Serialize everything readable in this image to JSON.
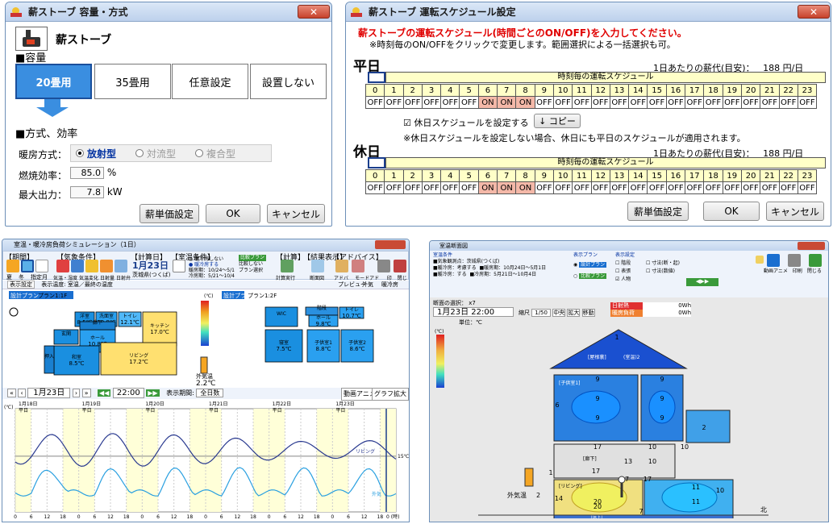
{
  "w1": {
    "title": "薪ストーブ 容量・方式",
    "close": "✕",
    "stove_name": "薪ストーブ",
    "capacity_heading": "■容量",
    "capacity_options": [
      "20畳用",
      "35畳用",
      "任意設定",
      "設置しない"
    ],
    "method_heading": "■方式、効率",
    "heating_label": "暖房方式：",
    "methods": [
      "放射型",
      "対流型",
      "複合型"
    ],
    "eff_label": "燃焼効率：",
    "eff_value": "85.0",
    "eff_unit": "%",
    "power_label": "最大出力：",
    "power_value": "7.8",
    "power_unit": "kW",
    "btn_price": "薪単価設定",
    "btn_ok": "OK",
    "btn_cancel": "キャンセル"
  },
  "w2": {
    "title": "薪ストーブ 運転スケジュール設定",
    "close": "✕",
    "instr1": "薪ストーブの運転スケジュール(時間ごとのON/OFF)を入力してください。",
    "instr2": "※時刻毎のON/OFFをクリックで変更します。範囲選択による一括選択も可。",
    "weekday": "平日",
    "holiday": "休日",
    "daily_label": "1日あたりの薪代(目安)：",
    "daily_value": "188 円/日",
    "grid_title": "時刻毎の運転スケジュール",
    "hours": [
      "0",
      "1",
      "2",
      "3",
      "4",
      "5",
      "6",
      "7",
      "8",
      "9",
      "10",
      "11",
      "12",
      "13",
      "14",
      "15",
      "16",
      "17",
      "18",
      "19",
      "20",
      "21",
      "22",
      "23"
    ],
    "weekday_states": [
      "OFF",
      "OFF",
      "OFF",
      "OFF",
      "OFF",
      "OFF",
      "ON",
      "ON",
      "ON",
      "OFF",
      "OFF",
      "OFF",
      "OFF",
      "OFF",
      "OFF",
      "OFF",
      "OFF",
      "OFF",
      "OFF",
      "OFF",
      "OFF",
      "OFF",
      "OFF",
      "OFF"
    ],
    "holiday_states": [
      "OFF",
      "OFF",
      "OFF",
      "OFF",
      "OFF",
      "OFF",
      "ON",
      "ON",
      "ON",
      "OFF",
      "OFF",
      "OFF",
      "OFF",
      "OFF",
      "OFF",
      "OFF",
      "OFF",
      "OFF",
      "OFF",
      "OFF",
      "OFF",
      "OFF",
      "OFF",
      "OFF"
    ],
    "holiday_check": "休日スケジュールを設定する",
    "copy_btn": "↓ コピー",
    "note": "※休日スケジュールを設定しない場合、休日にも平日のスケジュールが適用されます。",
    "btn_price": "薪単価設定",
    "btn_ok": "OK",
    "btn_cancel": "キャンセル"
  },
  "w3": {
    "title": "室温・暖冷房負荷シミュレーション（1日）",
    "toolbar_groups": [
      "【期間】",
      "【気象条件】",
      "【計算日】",
      "【室温条件】",
      "【計算】",
      "【結果表示】",
      "【アドバイス】"
    ],
    "season_btns": [
      "夏",
      "冬",
      "指定月"
    ],
    "weather_btns": [
      "気温・湿度",
      "気温変化",
      "日射量",
      "日射弁",
      "雨雪"
    ],
    "date_big": "1月23日",
    "location": "茨城県(つくば)",
    "cond_radio1": "暖冷房しない",
    "cond_radio2": "暖冷房する",
    "heat_period": "暖房期：10/24～5/1",
    "cool_period": "冷房期：5/21～10/4",
    "compare_btns": [
      "比較プラン",
      "比較しない",
      "プラン選択"
    ],
    "calc_btn": "計算実行",
    "floor_btn": "断面図",
    "adv_btn1": "アドバイス",
    "adv_btn2": "モードアドバイス",
    "print_btn": "印刷",
    "close_btn": "閉じる",
    "tab_display": "表示設定",
    "display_label": "表示温度: 室温／最終の温度",
    "tab_preview": "プレビュー",
    "tab_outdoor": "外気",
    "tab_heat": "暖冷房",
    "plan1": "設計プラン",
    "plan1_floor": "プラン1:1F",
    "plan2": "設計プラン",
    "plan2_floor": "プラン1:2F",
    "rooms_1f": [
      {
        "n": "洋室",
        "t": "8.5℃"
      },
      {
        "n": "洗面室",
        "t": "10.8℃"
      },
      {
        "n": "トイレ",
        "t": "12.1℃"
      },
      {
        "n": "キッチン",
        "t": "17.0℃"
      },
      {
        "n": "玄関",
        "t": ""
      },
      {
        "n": "ホール",
        "t": "10.8℃"
      },
      {
        "n": "和室",
        "t": "8.5℃"
      },
      {
        "n": "リビング",
        "t": "17.2℃"
      },
      {
        "n": "廊下",
        "t": ""
      },
      {
        "n": "押入",
        "t": ""
      }
    ],
    "rooms_2f": [
      {
        "n": "WIC",
        "t": ""
      },
      {
        "n": "階段",
        "t": ""
      },
      {
        "n": "トイレ",
        "t": "10.7℃"
      },
      {
        "n": "ホール",
        "t": "9.8℃"
      },
      {
        "n": "寝室",
        "t": "7.5℃"
      },
      {
        "n": "子供室1",
        "t": "8.8℃"
      },
      {
        "n": "子供室2",
        "t": "8.6℃"
      }
    ],
    "legend_unit": "(℃)",
    "outside_label": "外気温",
    "outside_temp": "2.2℃",
    "nav_date": "1月23日",
    "nav_time": "22:00",
    "period_label": "表示期間:",
    "period_value": "全日数",
    "btn_anim": "動画アニメ",
    "btn_graph": "グラフ拡大",
    "chart_dates": [
      "1月18日",
      "1月19日",
      "1月20日",
      "1月21日",
      "1月22日",
      "1月23日"
    ],
    "chart_day": "平日",
    "chart_yunit": "(℃)",
    "series_living": "リビング",
    "series_outside": "外気",
    "value_15": "15℃",
    "xlabel": "0 (時)"
  },
  "w4": {
    "title": "室温断面図",
    "cond_heading": "室温条件",
    "cond1": "■気象観測点：茨城県(つくば)",
    "cond2": "■暖冷房：考慮する",
    "cond3": "■暖房期：10月24日～5月1日",
    "cond4": "■暖冷房：する",
    "cond5": "■冷房期：5月21日～10月4日",
    "plan_heading": "表示プラン",
    "plan_design": "設計プラン",
    "plan_compare": "比較プラン",
    "set_heading": "表示設定",
    "checks": [
      "階段",
      "表張",
      "人物",
      "寸法(断・起)",
      "寸法(数値)"
    ],
    "btn_anim": "動画アニメ",
    "btn_print": "印刷",
    "btn_close": "閉じる",
    "section_label": "断面の選択：",
    "section_value": "x7",
    "date_time": "1月23日 22:00",
    "scale_label": "縮尺",
    "scale_value": "1/50",
    "btn_center": "中央",
    "btn_zoom": "拡大",
    "btn_move": "移動",
    "legend_red": "日射熱",
    "legend_red_val": "0Wh",
    "legend_orange": "暖房負荷",
    "legend_orange_val": "0Wh",
    "unit": "単位：℃",
    "legend_unit": "(℃)",
    "roof_label": "[屋根裏]",
    "roof_val": "(室温)2",
    "room_child": "[子供室1]",
    "room_living": "[リビング]",
    "room_underfloor": "[床下]",
    "room_stair": "[廊下]",
    "numbers": [
      "1",
      "9",
      "9",
      "9",
      "6",
      "9",
      "9",
      "9",
      "17",
      "13",
      "10",
      "10",
      "10",
      "17",
      "17",
      "17",
      "14",
      "20",
      "20",
      "11",
      "11",
      "10",
      "2",
      "7",
      "1"
    ],
    "outside_label": "外気温",
    "outside_val": "2",
    "north": "北"
  }
}
